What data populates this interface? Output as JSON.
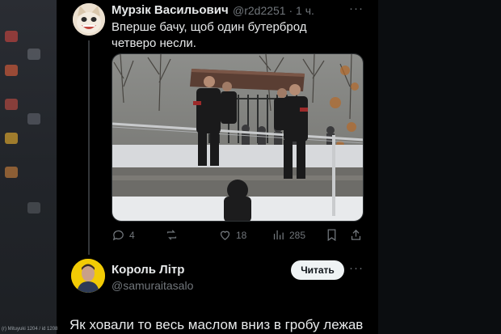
{
  "tweet1": {
    "author_name": "Мурзік Васильович",
    "author_handle": "@r2d2251",
    "time_sep": "·",
    "time": "1 ч.",
    "text": "Вперше бачу, щоб один бутерброд четверо несли.",
    "stats": {
      "replies": "4",
      "retweets": "",
      "likes": "18",
      "views": "285"
    },
    "more_label": "···"
  },
  "tweet2": {
    "author_name": "Король Літр",
    "author_handle": "@samuraitasalo",
    "follow_label": "Читать",
    "more_label": "···",
    "text": "Як ховали то весь маслом вниз в гробу лежав"
  },
  "watermark": "(r) Mituyuki 1204 / id 1208",
  "icons": {
    "reply": "reply-icon",
    "retweet": "retweet-icon",
    "like": "like-icon",
    "views": "views-icon",
    "bookmark": "bookmark-icon",
    "share": "share-icon"
  },
  "colors": {
    "background": "#000000",
    "text_primary": "#e7e9ea",
    "text_secondary": "#71767b",
    "divider": "#2f3336",
    "follow_button_bg": "#eff3f4",
    "follow_button_text": "#0f1419"
  }
}
